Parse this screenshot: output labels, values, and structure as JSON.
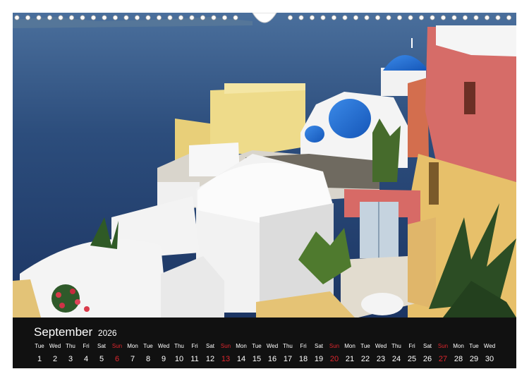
{
  "calendar": {
    "month": "September",
    "year": "2026",
    "days": [
      {
        "wd": "Tue",
        "d": "1"
      },
      {
        "wd": "Wed",
        "d": "2"
      },
      {
        "wd": "Thu",
        "d": "3"
      },
      {
        "wd": "Fri",
        "d": "4"
      },
      {
        "wd": "Sat",
        "d": "5"
      },
      {
        "wd": "Sun",
        "d": "6"
      },
      {
        "wd": "Mon",
        "d": "7"
      },
      {
        "wd": "Tue",
        "d": "8"
      },
      {
        "wd": "Wed",
        "d": "9"
      },
      {
        "wd": "Thu",
        "d": "10"
      },
      {
        "wd": "Fri",
        "d": "11"
      },
      {
        "wd": "Sat",
        "d": "12"
      },
      {
        "wd": "Sun",
        "d": "13"
      },
      {
        "wd": "Mon",
        "d": "14"
      },
      {
        "wd": "Tue",
        "d": "15"
      },
      {
        "wd": "Wed",
        "d": "16"
      },
      {
        "wd": "Thu",
        "d": "17"
      },
      {
        "wd": "Fri",
        "d": "18"
      },
      {
        "wd": "Sat",
        "d": "19"
      },
      {
        "wd": "Sun",
        "d": "20"
      },
      {
        "wd": "Mon",
        "d": "21"
      },
      {
        "wd": "Tue",
        "d": "22"
      },
      {
        "wd": "Wed",
        "d": "23"
      },
      {
        "wd": "Thu",
        "d": "24"
      },
      {
        "wd": "Fri",
        "d": "25"
      },
      {
        "wd": "Sat",
        "d": "26"
      },
      {
        "wd": "Sun",
        "d": "27"
      },
      {
        "wd": "Mon",
        "d": "28"
      },
      {
        "wd": "Tue",
        "d": "29"
      },
      {
        "wd": "Wed",
        "d": "30"
      }
    ]
  },
  "colors": {
    "sunday": "#e0262d",
    "bar_background": "#111111",
    "text": "#ffffff",
    "sea": "#2f4f7f",
    "dome_blue": "#1f6fd0"
  },
  "icons": [
    "spiral-binding-icon",
    "hanger-hole-icon"
  ]
}
